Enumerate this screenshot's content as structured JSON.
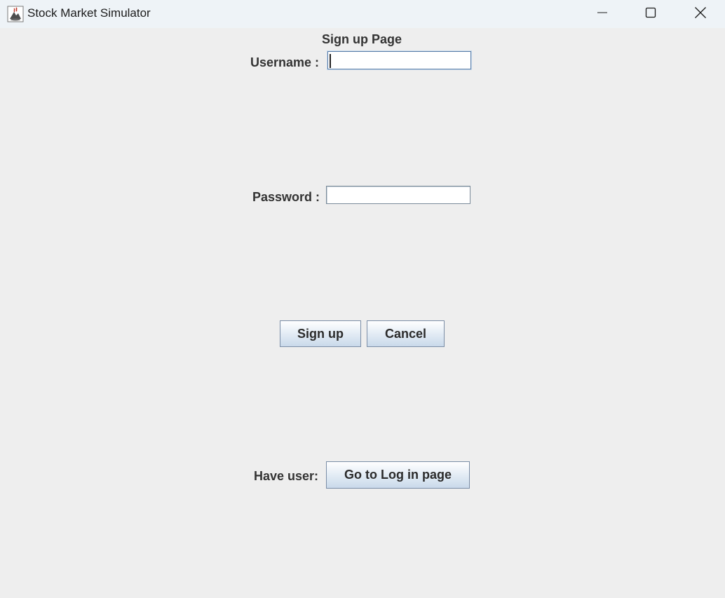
{
  "window": {
    "title": "Stock Market Simulator",
    "icon": "java-cup-icon",
    "controls": [
      "minimize-icon",
      "maximize-icon",
      "close-icon"
    ]
  },
  "form": {
    "heading": "Sign up Page",
    "username_label": "Username :",
    "username_value": "",
    "password_label": "Password :",
    "password_value": "",
    "signup_label": "Sign up",
    "cancel_label": "Cancel",
    "have_user_label": "Have user:",
    "login_button_label": "Go to Log in page"
  },
  "colors": {
    "background": "#eeeeee",
    "titlebar": "#eef3f7",
    "button_border": "#7a8da6"
  }
}
